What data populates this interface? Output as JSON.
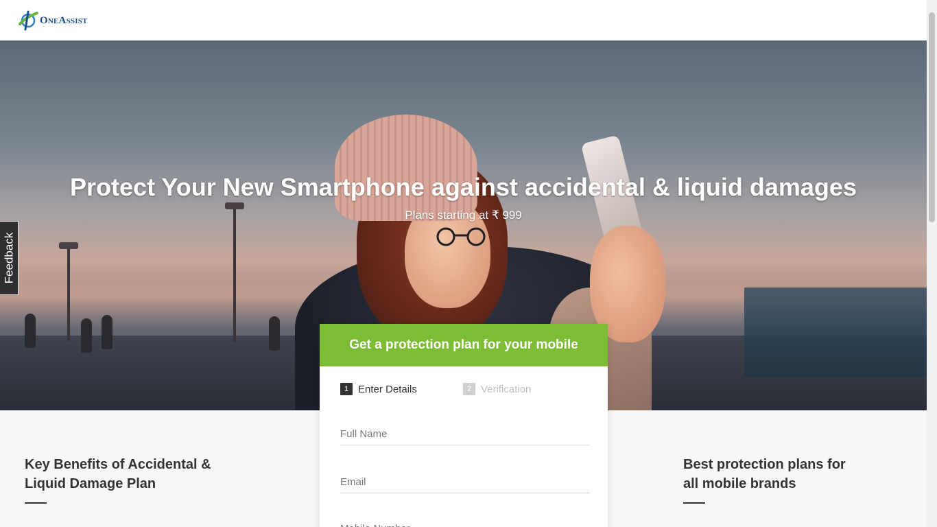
{
  "header": {
    "logo_text": "OneAssist"
  },
  "hero": {
    "title": "Protect Your New Smartphone against accidental & liquid damages",
    "subtitle": "Plans starting at ₹ 999"
  },
  "feedback": {
    "label": "Feedback"
  },
  "form": {
    "title": "Get a protection plan for your mobile",
    "steps": [
      {
        "number": "1",
        "label": "Enter Details",
        "active": true
      },
      {
        "number": "2",
        "label": "Verification",
        "active": false
      }
    ],
    "fields": {
      "full_name_placeholder": "Full Name",
      "email_placeholder": "Email",
      "mobile_placeholder": "Mobile Number"
    },
    "header_color": "#7cbd35"
  },
  "benefits": {
    "title": "Key Benefits of Accidental & Liquid Damage Plan"
  },
  "brands": {
    "title": "Best protection plans for all mobile brands"
  }
}
